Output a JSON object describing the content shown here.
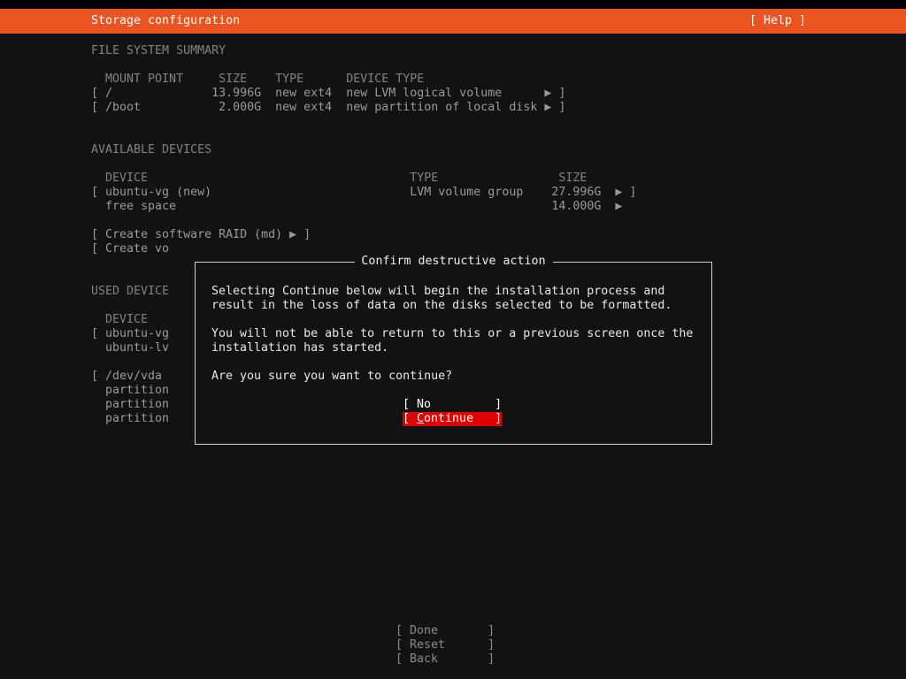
{
  "titlebar": {
    "title": "Storage configuration",
    "help_label": "[ Help ]"
  },
  "colors": {
    "accent_orange": "#E95420",
    "highlight_red": "#E00000",
    "background": "#121212"
  },
  "file_system_summary": {
    "heading": "FILE SYSTEM SUMMARY",
    "header_row": "  MOUNT POINT     SIZE    TYPE      DEVICE TYPE",
    "rows": [
      "[ /              13.996G  new ext4  new LVM logical volume      ▶ ]",
      "[ /boot           2.000G  new ext4  new partition of local disk ▶ ]"
    ]
  },
  "available_devices": {
    "heading": "AVAILABLE DEVICES",
    "header_row": "  DEVICE                                     TYPE                 SIZE",
    "rows": [
      "[ ubuntu-vg (new)                            LVM volume group    27.996G  ▶ ]",
      "  free space                                                     14.000G  ▶"
    ],
    "create_raid_label": "[ Create software RAID (md) ▶ ]",
    "create_vg_label": "[ Create vo"
  },
  "used_devices": {
    "heading": "USED DEVICE",
    "lines": [
      "  DEVICE",
      "[ ubuntu-vg",
      "  ubuntu-lv",
      "[ /dev/vda",
      "  partition",
      "  partition",
      "  partition"
    ]
  },
  "dialog": {
    "title": "Confirm destructive action",
    "body_lines": [
      "Selecting Continue below will begin the installation process and",
      "result in the loss of data on the disks selected to be formatted.",
      "You will not be able to return to this or a previous screen once the",
      "installation has started.",
      "Are you sure you want to continue?"
    ],
    "no_button": "[ No         ]",
    "continue_button": {
      "prefix": "[ ",
      "accelerator": "C",
      "suffix": "ontinue   ]"
    }
  },
  "footer": {
    "done_label": "[ Done       ]",
    "reset_label": "[ Reset      ]",
    "back_label": "[ Back       ]"
  }
}
